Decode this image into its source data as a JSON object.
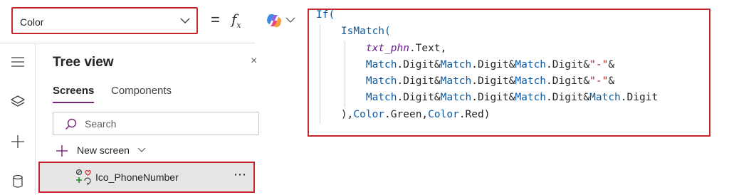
{
  "formula_bar": {
    "property_selected": "Color",
    "equals_sign": "=",
    "fx_label": "fx"
  },
  "formula": {
    "lines": [
      [
        {
          "t": "If(",
          "c": "kw"
        }
      ],
      [
        {
          "t": "    ",
          "c": "plain"
        },
        {
          "t": "IsMatch(",
          "c": "kw"
        }
      ],
      [
        {
          "t": "        ",
          "c": "plain"
        },
        {
          "t": "txt_phn",
          "c": "ctl"
        },
        {
          "t": ".Text,",
          "c": "plain"
        }
      ],
      [
        {
          "t": "        ",
          "c": "plain"
        },
        {
          "t": "Match",
          "c": "kw"
        },
        {
          "t": ".Digit&",
          "c": "plain"
        },
        {
          "t": "Match",
          "c": "kw"
        },
        {
          "t": ".Digit&",
          "c": "plain"
        },
        {
          "t": "Match",
          "c": "kw"
        },
        {
          "t": ".Digit&",
          "c": "plain"
        },
        {
          "t": "\"-\"",
          "c": "str"
        },
        {
          "t": "&",
          "c": "plain"
        }
      ],
      [
        {
          "t": "        ",
          "c": "plain"
        },
        {
          "t": "Match",
          "c": "kw"
        },
        {
          "t": ".Digit&",
          "c": "plain"
        },
        {
          "t": "Match",
          "c": "kw"
        },
        {
          "t": ".Digit&",
          "c": "plain"
        },
        {
          "t": "Match",
          "c": "kw"
        },
        {
          "t": ".Digit&",
          "c": "plain"
        },
        {
          "t": "\"-\"",
          "c": "str"
        },
        {
          "t": "&",
          "c": "plain"
        }
      ],
      [
        {
          "t": "        ",
          "c": "plain"
        },
        {
          "t": "Match",
          "c": "kw"
        },
        {
          "t": ".Digit&",
          "c": "plain"
        },
        {
          "t": "Match",
          "c": "kw"
        },
        {
          "t": ".Digit&",
          "c": "plain"
        },
        {
          "t": "Match",
          "c": "kw"
        },
        {
          "t": ".Digit&",
          "c": "plain"
        },
        {
          "t": "Match",
          "c": "kw"
        },
        {
          "t": ".Digit",
          "c": "plain"
        }
      ],
      [
        {
          "t": "    ",
          "c": "plain"
        },
        {
          "t": "),",
          "c": "plain"
        },
        {
          "t": "Color",
          "c": "kw"
        },
        {
          "t": ".Green,",
          "c": "plain"
        },
        {
          "t": "Color",
          "c": "kw"
        },
        {
          "t": ".Red)",
          "c": "plain"
        }
      ]
    ]
  },
  "left_rail": {
    "items": [
      {
        "icon": "hamburger-menu-icon"
      },
      {
        "icon": "layers-icon",
        "active": true
      },
      {
        "icon": "plus-icon"
      },
      {
        "icon": "database-icon"
      }
    ]
  },
  "tree_view": {
    "title": "Tree view",
    "close_glyph": "×",
    "tabs": [
      "Screens",
      "Components"
    ],
    "search_placeholder": "Search",
    "new_screen_label": "New screen",
    "screens": [
      {
        "name": "Ico_PhoneNumber",
        "more": "⋯"
      }
    ]
  },
  "colors": {
    "highlight_border": "#c4262e",
    "keyword": "#0b59a1",
    "string": "#a31515",
    "control_name": "#6a1f8c",
    "tab_underline": "#742774"
  }
}
